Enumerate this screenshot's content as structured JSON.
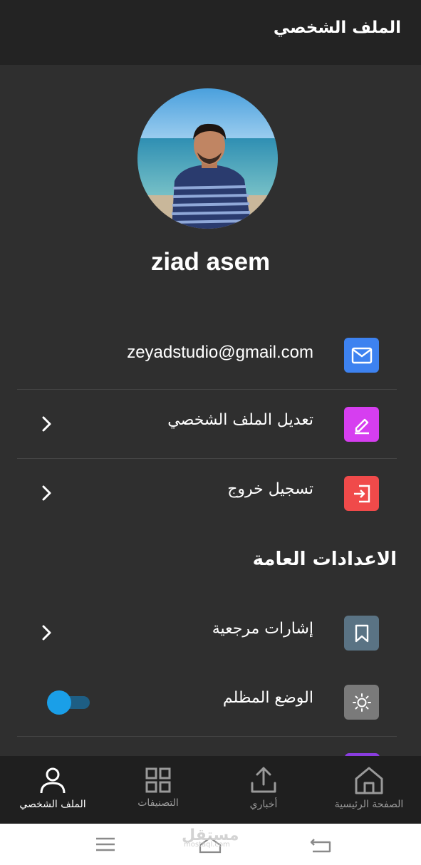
{
  "app_bar": {
    "title": "الملف الشخصي"
  },
  "profile": {
    "name": "ziad asem"
  },
  "account_rows": [
    {
      "label": "zeyadstudio@gmail.com",
      "icon": "mail-icon",
      "color": "#3d82f0"
    },
    {
      "label": "تعديل الملف الشخصي",
      "icon": "edit-icon",
      "color": "#d63ef0"
    },
    {
      "label": "تسجيل خروج",
      "icon": "logout-icon",
      "color": "#f04a4a"
    }
  ],
  "settings": {
    "title": "الاعدادات العامة",
    "rows": [
      {
        "label": "إشارات مرجعية",
        "icon": "bookmark-icon",
        "color": "#5a7384"
      },
      {
        "label": "الوضع المظلم",
        "icon": "sun-icon",
        "color": "#7a7a7a",
        "toggle_on": true
      }
    ]
  },
  "bottom_nav": [
    {
      "label": "الملف الشخصي",
      "icon": "user-icon",
      "active": true
    },
    {
      "label": "التصنيفات",
      "icon": "grid-icon",
      "active": false
    },
    {
      "label": "أخباري",
      "icon": "upload-icon",
      "active": false
    },
    {
      "label": "الصفحة الرئيسية",
      "icon": "home-icon",
      "active": false
    }
  ],
  "watermark": {
    "text": "مستقل",
    "sub": "mostaql.com"
  },
  "colors": {
    "background": "#2f2f2f",
    "app_bar": "#232323",
    "nav_bar": "#1f1f1f",
    "toggle": "#1a9fe8"
  }
}
